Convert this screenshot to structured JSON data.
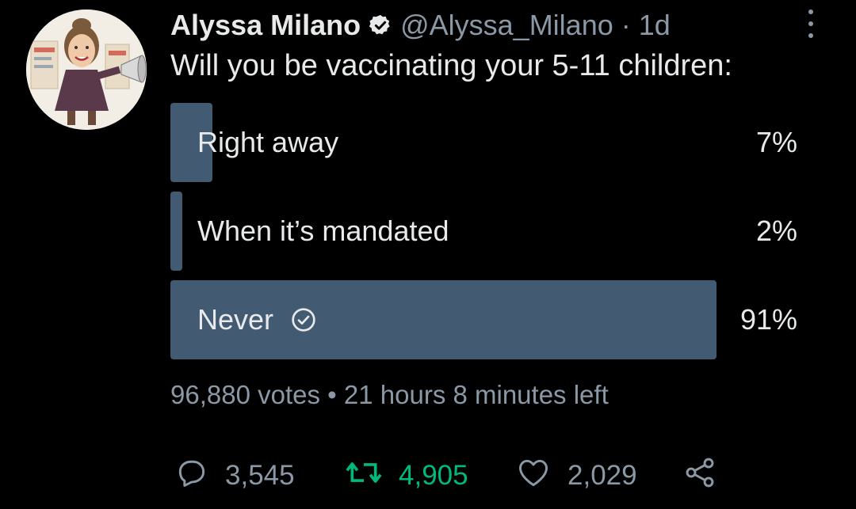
{
  "tweet": {
    "author_name": "Alyssa Milano",
    "handle": "@Alyssa_Milano",
    "separator": "·",
    "time": "1d",
    "text": "Will you be vaccinating your 5-11 children:"
  },
  "poll": {
    "options": [
      {
        "label": "Right away",
        "percent_text": "7%",
        "percent": 7
      },
      {
        "label": "When it’s mandated",
        "percent_text": "2%",
        "percent": 2
      },
      {
        "label": "Never",
        "percent_text": "91%",
        "percent": 91,
        "winner": true
      }
    ],
    "votes": "96,880 votes",
    "meta_separator": "•",
    "time_left": "21 hours 8 minutes left"
  },
  "actions": {
    "replies": "3,545",
    "retweets": "4,905",
    "likes": "2,029"
  },
  "icons": {
    "verified": "verified-badge-icon",
    "more": "more-options-icon",
    "check": "check-circle-icon",
    "reply": "reply-icon",
    "retweet": "retweet-icon",
    "like": "heart-icon",
    "share": "share-icon"
  },
  "colors": {
    "background": "#000000",
    "bar": "#425b73",
    "text": "#e7e9ea",
    "muted": "#8b98a5",
    "retweet_active": "#00ba7c"
  }
}
